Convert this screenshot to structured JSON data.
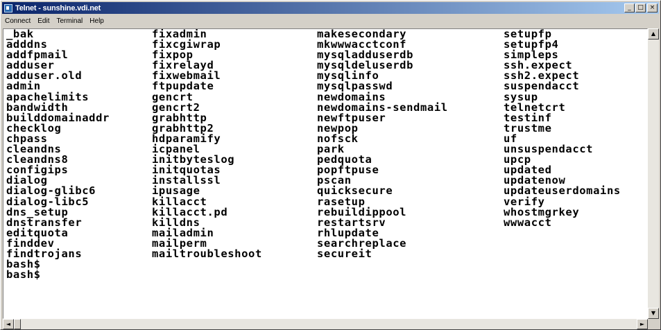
{
  "window": {
    "title": "Telnet - sunshine.vdi.net",
    "buttons": {
      "minimize": "_",
      "maximize": "□",
      "close": "×"
    }
  },
  "menu": [
    "Connect",
    "Edit",
    "Terminal",
    "Help"
  ],
  "terminal": {
    "columns": [
      [
        "_bak",
        "adddns",
        "addfpmail",
        "adduser",
        "adduser.old",
        "admin",
        "apachelimits",
        "bandwidth",
        "builddomainaddr",
        "checklog",
        "chpass",
        "cleandns",
        "cleandns8",
        "configips",
        "dialog",
        "dialog-glibc6",
        "dialog-libc5",
        "dns_setup",
        "dnstransfer",
        "editquota",
        "finddev",
        "findtrojans"
      ],
      [
        "fixadmin",
        "fixcgiwrap",
        "fixpop",
        "fixrelayd",
        "fixwebmail",
        "ftpupdate",
        "gencrt",
        "gencrt2",
        "grabhttp",
        "grabhttp2",
        "hdparamify",
        "icpanel",
        "initbyteslog",
        "initquotas",
        "installssl",
        "ipusage",
        "killacct",
        "killacct.pd",
        "killdns",
        "mailadmin",
        "mailperm",
        "mailtroubleshoot"
      ],
      [
        "makesecondary",
        "mkwwwacctconf",
        "mysqladduserdb",
        "mysqldeluserdb",
        "mysqlinfo",
        "mysqlpasswd",
        "newdomains",
        "newdomains-sendmail",
        "newftpuser",
        "newpop",
        "nofsck",
        "park",
        "pedquota",
        "popftpuse",
        "pscan",
        "quicksecure",
        "rasetup",
        "rebuildippool",
        "restartsrv",
        "rhlupdate",
        "searchreplace",
        "secureit"
      ],
      [
        "setupfp",
        "setupfp4",
        "simpleps",
        "ssh.expect",
        "ssh2.expect",
        "suspendacct",
        "sysup",
        "telnetcrt",
        "testinf",
        "trustme",
        "uf",
        "unsuspendacct",
        "upcp",
        "updated",
        "updatenow",
        "updateuserdomains",
        "verify",
        "whostmgrkey",
        "wwwacct"
      ]
    ],
    "prompts": [
      "bash$",
      "bash$"
    ]
  },
  "scrollbars": {
    "up": "▲",
    "down": "▼",
    "left": "◄",
    "right": "►"
  }
}
